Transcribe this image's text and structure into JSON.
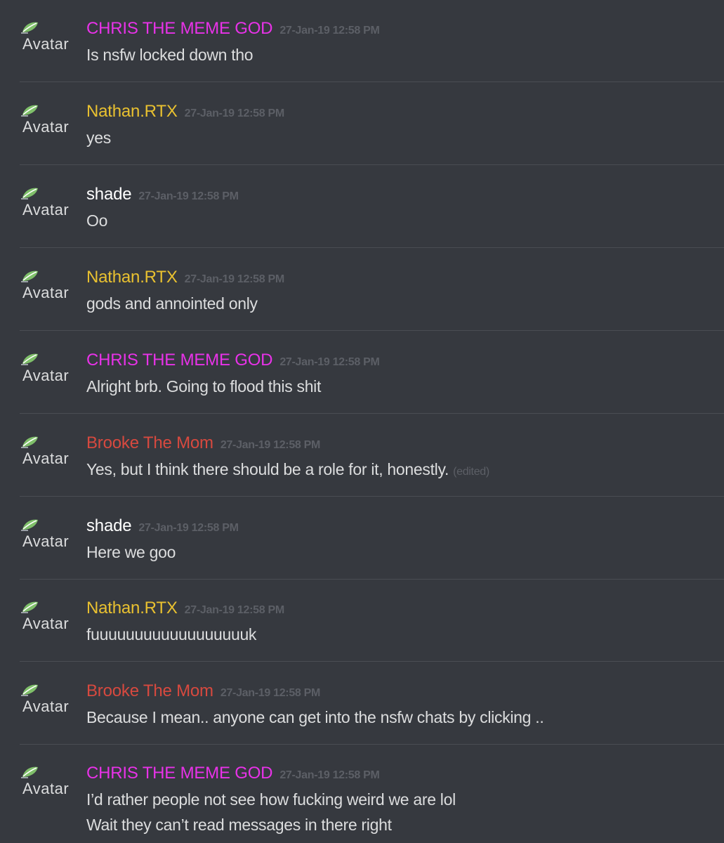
{
  "avatar_alt": "Avatar",
  "colors": {
    "chris": "#e832e8",
    "nathan": "#e9c130",
    "shade": "#ffffff",
    "brooke": "#d7493f"
  },
  "messages": [
    {
      "username": "CHRIS THE MEME GOD",
      "timestamp": "27-Jan-19 12:58 PM",
      "lines": [
        "Is nsfw locked down tho"
      ],
      "edited": ""
    },
    {
      "username": "Nathan.RTX",
      "timestamp": "27-Jan-19 12:58 PM",
      "lines": [
        "yes"
      ],
      "edited": ""
    },
    {
      "username": "shade",
      "timestamp": "27-Jan-19 12:58 PM",
      "lines": [
        "Oo"
      ],
      "edited": ""
    },
    {
      "username": "Nathan.RTX",
      "timestamp": "27-Jan-19 12:58 PM",
      "lines": [
        "gods and annointed only"
      ],
      "edited": ""
    },
    {
      "username": "CHRIS THE MEME GOD",
      "timestamp": "27-Jan-19 12:58 PM",
      "lines": [
        "Alright brb. Going to flood this shit"
      ],
      "edited": ""
    },
    {
      "username": "Brooke The Mom",
      "timestamp": "27-Jan-19 12:58 PM",
      "lines": [
        "Yes, but I think there should be a role for it, honestly."
      ],
      "edited": "(edited)"
    },
    {
      "username": "shade",
      "timestamp": "27-Jan-19 12:58 PM",
      "lines": [
        "Here we goo"
      ],
      "edited": ""
    },
    {
      "username": "Nathan.RTX",
      "timestamp": "27-Jan-19 12:58 PM",
      "lines": [
        "fuuuuuuuuuuuuuuuuuuk"
      ],
      "edited": ""
    },
    {
      "username": "Brooke The Mom",
      "timestamp": "27-Jan-19 12:58 PM",
      "lines": [
        "Because I mean.. anyone can get into the nsfw chats by clicking .."
      ],
      "edited": ""
    },
    {
      "username": "CHRIS THE MEME GOD",
      "timestamp": "27-Jan-19 12:58 PM",
      "lines": [
        "I’d rather people not see how fucking weird we are lol",
        "Wait they can’t read messages in there right"
      ],
      "edited": ""
    }
  ]
}
